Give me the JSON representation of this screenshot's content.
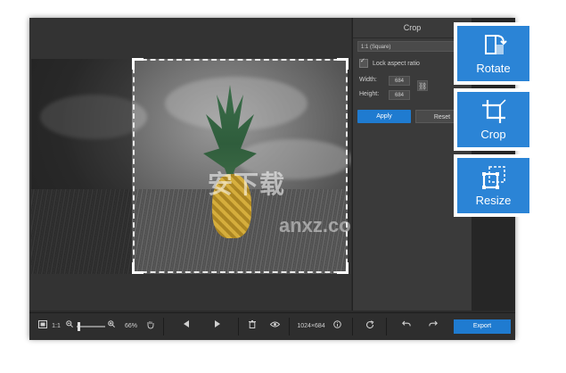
{
  "panel": {
    "title": "Crop",
    "preset": "1:1 (Square)",
    "lock_label": "Lock aspect ratio",
    "width_label": "Width:",
    "width_value": "684",
    "height_label": "Height:",
    "height_value": "684",
    "apply_label": "Apply",
    "reset_label": "Reset"
  },
  "toolbar": {
    "fit_label": "1:1",
    "zoom_label": "66%",
    "zoom_fraction": 0.05,
    "dimensions": "1024×684",
    "export_label": "Export"
  },
  "tools": [
    {
      "label": "Rotate",
      "icon": "rotate-icon"
    },
    {
      "label": "Crop",
      "icon": "crop-icon"
    },
    {
      "label": "Resize",
      "icon": "resize-icon"
    }
  ],
  "watermark": {
    "text": "安下载",
    "sub": "anxz.com"
  },
  "colors": {
    "accent": "#1f7bd0",
    "tool_card": "#2b84d6"
  }
}
